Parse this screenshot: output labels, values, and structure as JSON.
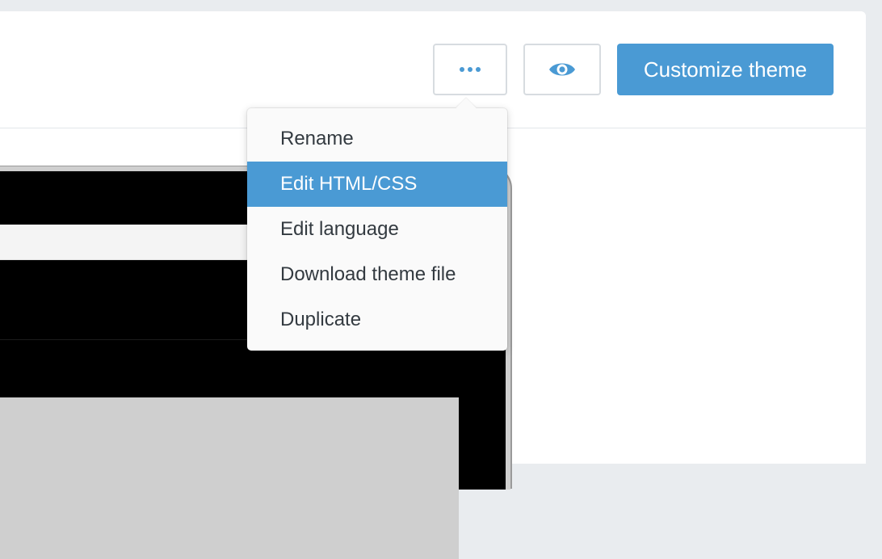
{
  "header": {
    "more_icon": "ellipsis-icon",
    "preview_icon": "eye-icon",
    "customize_label": "Customize theme"
  },
  "dropdown": {
    "items": [
      {
        "label": "Rename",
        "active": false
      },
      {
        "label": "Edit HTML/CSS",
        "active": true
      },
      {
        "label": "Edit language",
        "active": false
      },
      {
        "label": "Download theme file",
        "active": false
      },
      {
        "label": "Duplicate",
        "active": false
      }
    ]
  },
  "colors": {
    "accent": "#4a9ad4",
    "background": "#e9ecef",
    "card": "#ffffff",
    "text": "#333a40"
  }
}
